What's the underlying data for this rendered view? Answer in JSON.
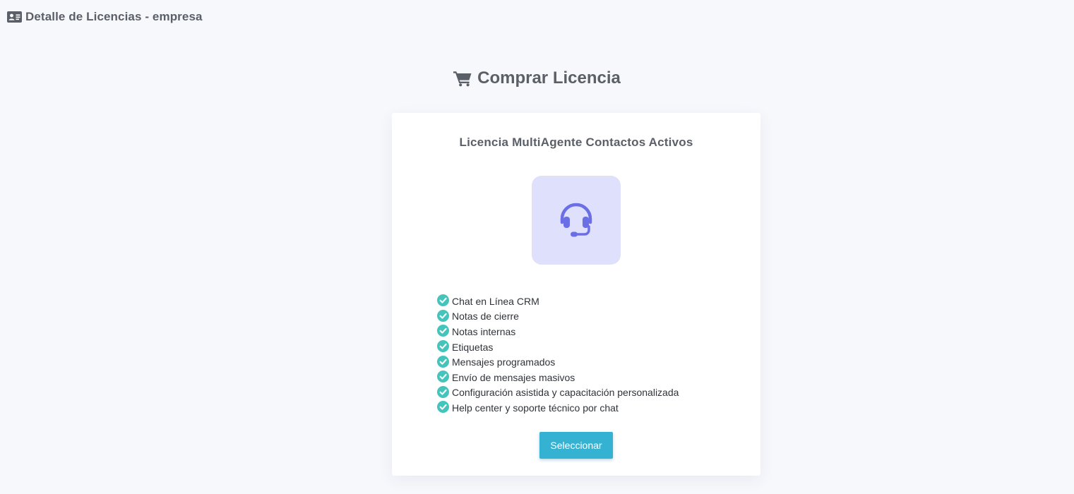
{
  "header": {
    "icon": "id-card-icon",
    "title": "Detalle de Licencias - empresa"
  },
  "section": {
    "icon": "shopping-cart-icon",
    "title": "Comprar Licencia"
  },
  "plan": {
    "title": "Licencia MultiAgente Contactos Activos",
    "icon": "headset-icon",
    "features_icon": "check-circle-icon",
    "features": [
      "Chat en Línea CRM",
      "Notas de cierre",
      "Notas internas",
      "Etiquetas",
      "Mensajes programados",
      "Envío de mensajes masivos",
      "Configuración asistida y capacitación personalizada",
      "Help center y soporte técnico por chat"
    ],
    "button_label": "Seleccionar"
  },
  "colors": {
    "background": "#f7f8fc",
    "card": "#ffffff",
    "accent_button": "#35b1d2",
    "check": "#45c4bb",
    "icon_tile": "#dfe0fb",
    "icon_glyph": "#6b6fe6",
    "heading_text": "#5b6068"
  }
}
